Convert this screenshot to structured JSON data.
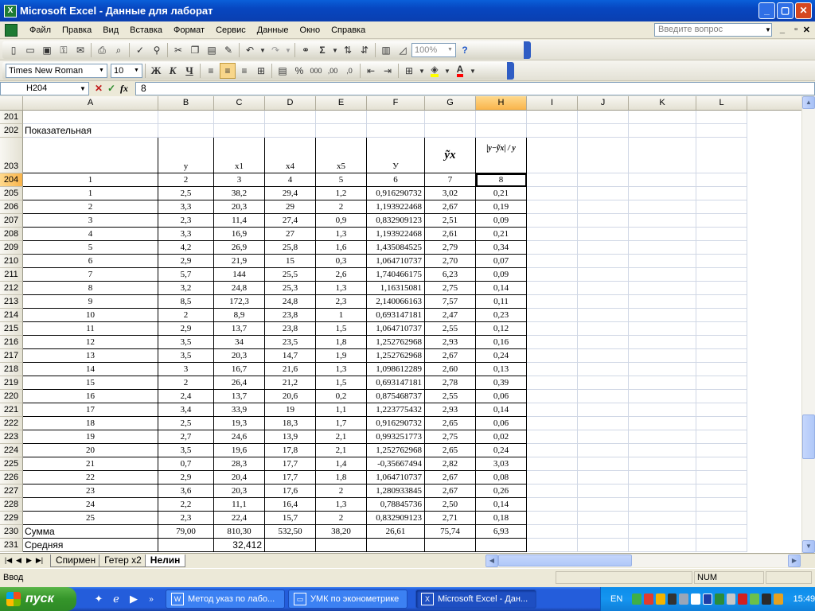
{
  "window": {
    "title": "Microsoft Excel - Данные для лаборат",
    "min": "_",
    "max": "▢",
    "close": "✕"
  },
  "menu": {
    "items": [
      {
        "label": "Файл",
        "name": "file"
      },
      {
        "label": "Правка",
        "name": "edit"
      },
      {
        "label": "Вид",
        "name": "view"
      },
      {
        "label": "Вставка",
        "name": "insert"
      },
      {
        "label": "Формат",
        "name": "format"
      },
      {
        "label": "Сервис",
        "name": "tools"
      },
      {
        "label": "Данные",
        "name": "data"
      },
      {
        "label": "Окно",
        "name": "window"
      },
      {
        "label": "Справка",
        "name": "help"
      }
    ],
    "ask_placeholder": "Введите вопрос"
  },
  "toolbar": {
    "zoom": "100%",
    "font": "Times New Roman",
    "font_size": "10",
    "bold": "Ж",
    "italic": "К",
    "underline": "Ч",
    "font_color": "#FF0000",
    "fill_color": "#FFFF00"
  },
  "formula": {
    "name_box": "H204",
    "cancel": "✕",
    "enter": "✓",
    "fx": "fx",
    "value": "8"
  },
  "sheet": {
    "columns": [
      "A",
      "B",
      "C",
      "D",
      "E",
      "F",
      "G",
      "H",
      "I",
      "J",
      "K",
      "L"
    ],
    "selected_column": "H",
    "selected_row": "204",
    "rows": [
      {
        "n": "201",
        "cells": {}
      },
      {
        "n": "202",
        "cells": {
          "A": "Показательная"
        }
      },
      {
        "n": "203",
        "cells": {
          "B": "y",
          "C": "x1",
          "D": "x4",
          "E": "x5",
          "F": "У",
          "G": "ỹx",
          "H": "|y−ỹx| / y"
        }
      },
      {
        "n": "204",
        "cells": {
          "A": "1",
          "B": "2",
          "C": "3",
          "D": "4",
          "E": "5",
          "F": "6",
          "G": "7",
          "H": "8"
        }
      },
      {
        "n": "205",
        "cells": {
          "A": "1",
          "B": "2,5",
          "C": "38,2",
          "D": "29,4",
          "E": "1,2",
          "F": "0,916290732",
          "G": "3,02",
          "H": "0,21"
        }
      },
      {
        "n": "206",
        "cells": {
          "A": "2",
          "B": "3,3",
          "C": "20,3",
          "D": "29",
          "E": "2",
          "F": "1,193922468",
          "G": "2,67",
          "H": "0,19"
        }
      },
      {
        "n": "207",
        "cells": {
          "A": "3",
          "B": "2,3",
          "C": "11,4",
          "D": "27,4",
          "E": "0,9",
          "F": "0,832909123",
          "G": "2,51",
          "H": "0,09"
        }
      },
      {
        "n": "208",
        "cells": {
          "A": "4",
          "B": "3,3",
          "C": "16,9",
          "D": "27",
          "E": "1,3",
          "F": "1,193922468",
          "G": "2,61",
          "H": "0,21"
        }
      },
      {
        "n": "209",
        "cells": {
          "A": "5",
          "B": "4,2",
          "C": "26,9",
          "D": "25,8",
          "E": "1,6",
          "F": "1,435084525",
          "G": "2,79",
          "H": "0,34"
        }
      },
      {
        "n": "210",
        "cells": {
          "A": "6",
          "B": "2,9",
          "C": "21,9",
          "D": "15",
          "E": "0,3",
          "F": "1,064710737",
          "G": "2,70",
          "H": "0,07"
        }
      },
      {
        "n": "211",
        "cells": {
          "A": "7",
          "B": "5,7",
          "C": "144",
          "D": "25,5",
          "E": "2,6",
          "F": "1,740466175",
          "G": "6,23",
          "H": "0,09"
        }
      },
      {
        "n": "212",
        "cells": {
          "A": "8",
          "B": "3,2",
          "C": "24,8",
          "D": "25,3",
          "E": "1,3",
          "F": "1,16315081",
          "G": "2,75",
          "H": "0,14"
        }
      },
      {
        "n": "213",
        "cells": {
          "A": "9",
          "B": "8,5",
          "C": "172,3",
          "D": "24,8",
          "E": "2,3",
          "F": "2,140066163",
          "G": "7,57",
          "H": "0,11"
        }
      },
      {
        "n": "214",
        "cells": {
          "A": "10",
          "B": "2",
          "C": "8,9",
          "D": "23,8",
          "E": "1",
          "F": "0,693147181",
          "G": "2,47",
          "H": "0,23"
        }
      },
      {
        "n": "215",
        "cells": {
          "A": "11",
          "B": "2,9",
          "C": "13,7",
          "D": "23,8",
          "E": "1,5",
          "F": "1,064710737",
          "G": "2,55",
          "H": "0,12"
        }
      },
      {
        "n": "216",
        "cells": {
          "A": "12",
          "B": "3,5",
          "C": "34",
          "D": "23,5",
          "E": "1,8",
          "F": "1,252762968",
          "G": "2,93",
          "H": "0,16"
        }
      },
      {
        "n": "217",
        "cells": {
          "A": "13",
          "B": "3,5",
          "C": "20,3",
          "D": "14,7",
          "E": "1,9",
          "F": "1,252762968",
          "G": "2,67",
          "H": "0,24"
        }
      },
      {
        "n": "218",
        "cells": {
          "A": "14",
          "B": "3",
          "C": "16,7",
          "D": "21,6",
          "E": "1,3",
          "F": "1,098612289",
          "G": "2,60",
          "H": "0,13"
        }
      },
      {
        "n": "219",
        "cells": {
          "A": "15",
          "B": "2",
          "C": "26,4",
          "D": "21,2",
          "E": "1,5",
          "F": "0,693147181",
          "G": "2,78",
          "H": "0,39"
        }
      },
      {
        "n": "220",
        "cells": {
          "A": "16",
          "B": "2,4",
          "C": "13,7",
          "D": "20,6",
          "E": "0,2",
          "F": "0,875468737",
          "G": "2,55",
          "H": "0,06"
        }
      },
      {
        "n": "221",
        "cells": {
          "A": "17",
          "B": "3,4",
          "C": "33,9",
          "D": "19",
          "E": "1,1",
          "F": "1,223775432",
          "G": "2,93",
          "H": "0,14"
        }
      },
      {
        "n": "222",
        "cells": {
          "A": "18",
          "B": "2,5",
          "C": "19,3",
          "D": "18,3",
          "E": "1,7",
          "F": "0,916290732",
          "G": "2,65",
          "H": "0,06"
        }
      },
      {
        "n": "223",
        "cells": {
          "A": "19",
          "B": "2,7",
          "C": "24,6",
          "D": "13,9",
          "E": "2,1",
          "F": "0,993251773",
          "G": "2,75",
          "H": "0,02"
        }
      },
      {
        "n": "224",
        "cells": {
          "A": "20",
          "B": "3,5",
          "C": "19,6",
          "D": "17,8",
          "E": "2,1",
          "F": "1,252762968",
          "G": "2,65",
          "H": "0,24"
        }
      },
      {
        "n": "225",
        "cells": {
          "A": "21",
          "B": "0,7",
          "C": "28,3",
          "D": "17,7",
          "E": "1,4",
          "F": "-0,35667494",
          "G": "2,82",
          "H": "3,03"
        }
      },
      {
        "n": "226",
        "cells": {
          "A": "22",
          "B": "2,9",
          "C": "20,4",
          "D": "17,7",
          "E": "1,8",
          "F": "1,064710737",
          "G": "2,67",
          "H": "0,08"
        }
      },
      {
        "n": "227",
        "cells": {
          "A": "23",
          "B": "3,6",
          "C": "20,3",
          "D": "17,6",
          "E": "2",
          "F": "1,280933845",
          "G": "2,67",
          "H": "0,26"
        }
      },
      {
        "n": "228",
        "cells": {
          "A": "24",
          "B": "2,2",
          "C": "11,1",
          "D": "16,4",
          "E": "1,3",
          "F": "0,78845736",
          "G": "2,50",
          "H": "0,14"
        }
      },
      {
        "n": "229",
        "cells": {
          "A": "25",
          "B": "2,3",
          "C": "22,4",
          "D": "15,7",
          "E": "2",
          "F": "0,832909123",
          "G": "2,71",
          "H": "0,18"
        }
      },
      {
        "n": "230",
        "cells": {
          "A": "Сумма",
          "B": "79,00",
          "C": "810,30",
          "D": "532,50",
          "E": "38,20",
          "F": "26,61",
          "G": "75,74",
          "H": "6,93"
        }
      },
      {
        "n": "231",
        "cells": {
          "A": "Средняя",
          "C": "32,412"
        }
      }
    ]
  },
  "tabs": [
    {
      "label": "Спирмен",
      "active": false
    },
    {
      "label": "Гетер х2",
      "active": false
    },
    {
      "label": "Нелин",
      "active": true
    }
  ],
  "status": {
    "mode": "Ввод",
    "num": "NUM"
  },
  "taskbar": {
    "start": "пуск",
    "tasks": [
      {
        "label": "Метод указ по лабо...",
        "active": false,
        "icon": "W"
      },
      {
        "label": "УМК по эконометрике",
        "active": false,
        "icon": "▭"
      },
      {
        "label": "Microsoft Excel - Дан...",
        "active": true,
        "icon": "X"
      }
    ],
    "lang": "EN",
    "time": "15:49"
  }
}
